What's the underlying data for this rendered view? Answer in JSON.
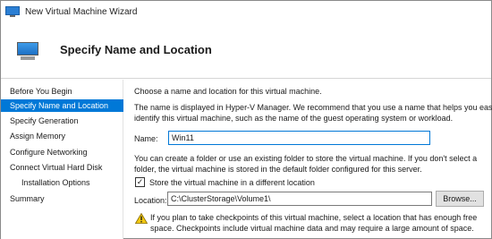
{
  "window": {
    "title": "New Virtual Machine Wizard"
  },
  "header": {
    "title": "Specify Name and Location"
  },
  "sidebar": {
    "items": [
      {
        "label": "Before You Begin"
      },
      {
        "label": "Specify Name and Location"
      },
      {
        "label": "Specify Generation"
      },
      {
        "label": "Assign Memory"
      },
      {
        "label": "Configure Networking"
      },
      {
        "label": "Connect Virtual Hard Disk"
      },
      {
        "label": "Installation Options"
      },
      {
        "label": "Summary"
      }
    ],
    "active_index": 1
  },
  "main": {
    "intro": "Choose a name and location for this virtual machine.",
    "name_help_line1": "The name is displayed in Hyper-V Manager. We recommend that you use a name that helps you easily",
    "name_help_line2": "identify this virtual machine, such as the name of the guest operating system or workload.",
    "name_label": "Name:",
    "name_value": "Win11",
    "folder_help_line1": "You can create a folder or use an existing folder to store the virtual machine. If you don't select a",
    "folder_help_line2": "folder, the virtual machine is stored in the default folder configured for this server.",
    "store_checkbox_label": "Store the virtual machine in a different location",
    "store_checked": true,
    "location_label": "Location:",
    "location_value": "C:\\ClusterStorage\\Volume1\\",
    "browse_label": "Browse...",
    "warning_line1": "If you plan to take checkpoints of this virtual machine, select a location that has enough free",
    "warning_line2": "space. Checkpoints include virtual machine data and may require a large amount of space."
  },
  "colors": {
    "accent": "#0078d7",
    "warning": "#f2c811"
  },
  "icons": {
    "title": "virtual-machine-icon",
    "header": "monitor-icon",
    "warning": "warning-icon"
  }
}
